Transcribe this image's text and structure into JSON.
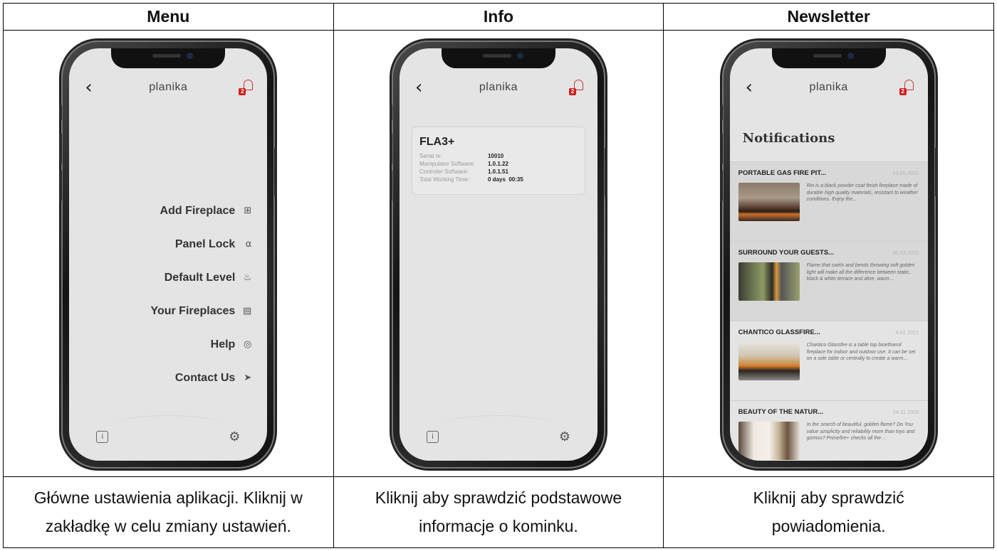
{
  "headers": [
    "Menu",
    "Info",
    "Newsletter"
  ],
  "captions": [
    [
      "Główne ustawienia aplikacji. Kliknij w",
      "zakładkę w celu zmiany ustawień."
    ],
    [
      "Kliknij aby sprawdzić podstawowe",
      "informacje o kominku."
    ],
    [
      "Kliknij aby sprawdzić",
      "powiadomienia."
    ]
  ],
  "app": {
    "brand": "planika",
    "bell_badge": "2",
    "icons": {
      "back": "chevron-left-icon",
      "bell": "bell-icon",
      "info": "info-icon",
      "settings": "gear-icon"
    }
  },
  "menu_screen": {
    "items": [
      {
        "label": "Add Fireplace",
        "icon": "plus-square-icon"
      },
      {
        "label": "Panel Lock",
        "icon": "lock-icon"
      },
      {
        "label": "Default Level",
        "icon": "flame-icon"
      },
      {
        "label": "Your Fireplaces",
        "icon": "fireplace-icon"
      },
      {
        "label": "Help",
        "icon": "lifebuoy-icon"
      },
      {
        "label": "Contact Us",
        "icon": "send-icon"
      }
    ]
  },
  "info_screen": {
    "model": "FLA3+",
    "rows": [
      {
        "key": "Serial nr:",
        "value": "10010"
      },
      {
        "key": "Manipulator Software:",
        "value": "1.0.1.22"
      },
      {
        "key": "Controler Software:",
        "value": "1.0.1.51"
      },
      {
        "key": "Total Working Time:",
        "value": "0 days  00:35"
      }
    ]
  },
  "newsletter_screen": {
    "title": "Notifications",
    "items": [
      {
        "title": "PORTABLE GAS FIRE PIT...",
        "date": "13.05.2021",
        "text": "Rio is a black powder coat finish fireplace made of durable high quality materials, resistant to weather conditions. Enjoy the..."
      },
      {
        "title": "SURROUND YOUR GUESTS...",
        "date": "20.03.2021",
        "text": "Flame that swirls and bends throwing soft golden light will make all the difference between static, black & white terrace and alive, warm..."
      },
      {
        "title": "CHANTICO GLASSFIRE...",
        "date": "4.01.2021",
        "text": "Chantico Glassfire is a table top bioethanol fireplace for indoor and outdoor use. It can be set on a side table or centrally to create a warm..."
      },
      {
        "title": "BEAUTY OF THE NATUR...",
        "date": "24.11.2020",
        "text": "In the search of beautiful, golden flame? Do You value simplicity and reliability more than toys and gizmos? Primefire+ checks all the ..."
      }
    ]
  }
}
